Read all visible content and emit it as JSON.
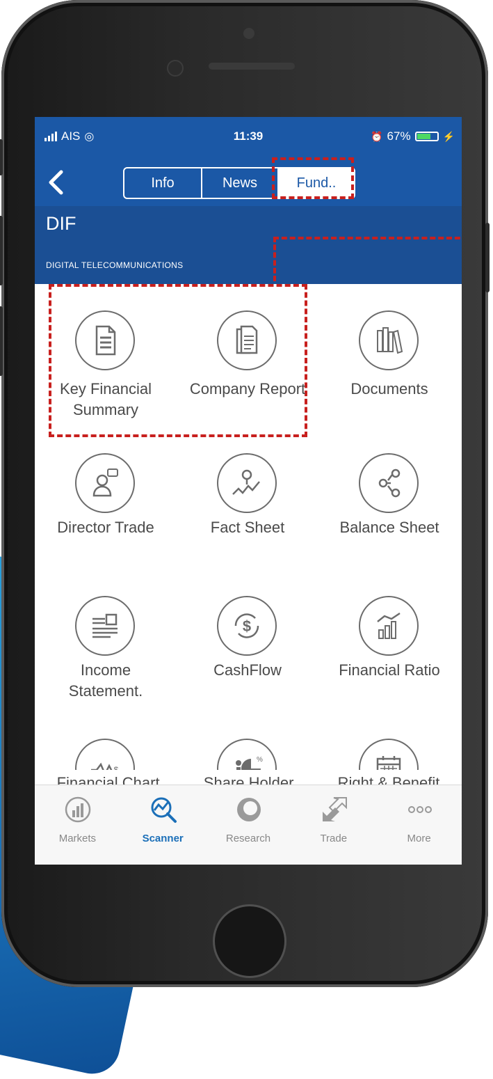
{
  "status_bar": {
    "carrier": "AIS",
    "time": "11:39",
    "battery": "67%",
    "battery_level": 0.67
  },
  "nav": {
    "back_label": "<",
    "tabs": [
      {
        "label": "Info",
        "active": false
      },
      {
        "label": "News",
        "active": false
      },
      {
        "label": "Fund..",
        "active": true
      }
    ]
  },
  "stock": {
    "symbol": "DIF",
    "name": "DIGITAL TELECOMMUNICATIONS"
  },
  "menu": [
    {
      "label": "Key Financial Summary",
      "icon": "document-icon"
    },
    {
      "label": "Company Report",
      "icon": "report-icon"
    },
    {
      "label": "Documents",
      "icon": "books-icon"
    },
    {
      "label": "Director Trade",
      "icon": "director-icon"
    },
    {
      "label": "Fact Sheet",
      "icon": "fact-sheet-icon"
    },
    {
      "label": "Balance Sheet",
      "icon": "balance-icon"
    },
    {
      "label": "Income Statement.",
      "icon": "income-icon"
    },
    {
      "label": "CashFlow",
      "icon": "cashflow-icon"
    },
    {
      "label": "Financial Ratio",
      "icon": "ratio-icon"
    },
    {
      "label": "Financial Chart",
      "icon": "chart-icon"
    },
    {
      "label": "Share Holder",
      "icon": "pie-icon"
    },
    {
      "label": "Right & Benefit",
      "icon": "calendar-icon"
    }
  ],
  "tabbar": [
    {
      "label": "Markets",
      "icon": "markets-icon",
      "active": false
    },
    {
      "label": "Scanner",
      "icon": "scanner-icon",
      "active": true
    },
    {
      "label": "Research",
      "icon": "research-icon",
      "active": false
    },
    {
      "label": "Trade",
      "icon": "trade-icon",
      "active": false
    },
    {
      "label": "More",
      "icon": "more-icon",
      "active": false
    }
  ],
  "colors": {
    "nav_blue": "#1b58a6",
    "header_blue": "#1b4f94",
    "highlight_red": "#c8201e",
    "active_tab": "#1b6fb8"
  }
}
